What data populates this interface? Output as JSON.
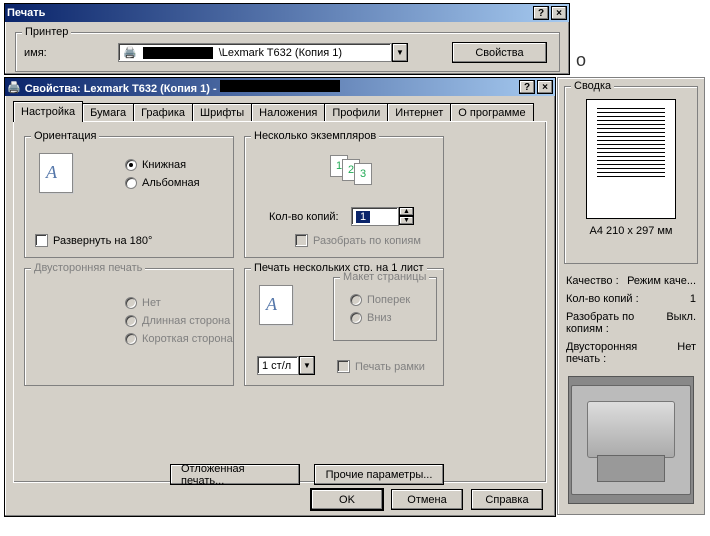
{
  "print_dialog": {
    "title": "Печать",
    "printer_group": "Принтер",
    "name_label": "имя:",
    "printer_name": "\\Lexmark T632 (Копия 1)",
    "props_button": "Свойства"
  },
  "props_dialog": {
    "title_prefix": "Свойства: Lexmark T632 (Копия 1) - ",
    "tabs": [
      "Настройка",
      "Бумага",
      "Графика",
      "Шрифты",
      "Наложения",
      "Профили",
      "Интернет",
      "О программе"
    ],
    "orientation": {
      "legend": "Ориентация",
      "portrait": "Книжная",
      "landscape": "Альбомная",
      "rotate": "Развернуть на 180°"
    },
    "copies": {
      "legend": "Несколько экземпляров",
      "count_label": "Кол-во копий:",
      "count_value": "1",
      "collate": "Разобрать по копиям"
    },
    "duplex": {
      "legend": "Двусторонняя печать",
      "none": "Нет",
      "long": "Длинная сторона",
      "short": "Короткая сторона"
    },
    "nup": {
      "legend": "Печать нескольких стр. на 1 лист",
      "layout_legend": "Макет страницы",
      "across": "Поперек",
      "down": "Вниз",
      "pages_per": "1 ст/л",
      "border": "Печать рамки"
    },
    "deferred": "Отложенная печать...",
    "other": "Прочие параметры...",
    "ok": "OK",
    "cancel": "Отмена",
    "help": "Справка"
  },
  "summary": {
    "legend": "Сводка",
    "paper": "A4 210 x 297 мм",
    "rows": [
      {
        "k": "Качество :",
        "v": "Режим каче..."
      },
      {
        "k": "Кол-во копий :",
        "v": "1"
      },
      {
        "k": "Разобрать по копиям :",
        "v": "Выкл."
      },
      {
        "k": "Двусторонняя печать :",
        "v": "Нет"
      }
    ]
  }
}
